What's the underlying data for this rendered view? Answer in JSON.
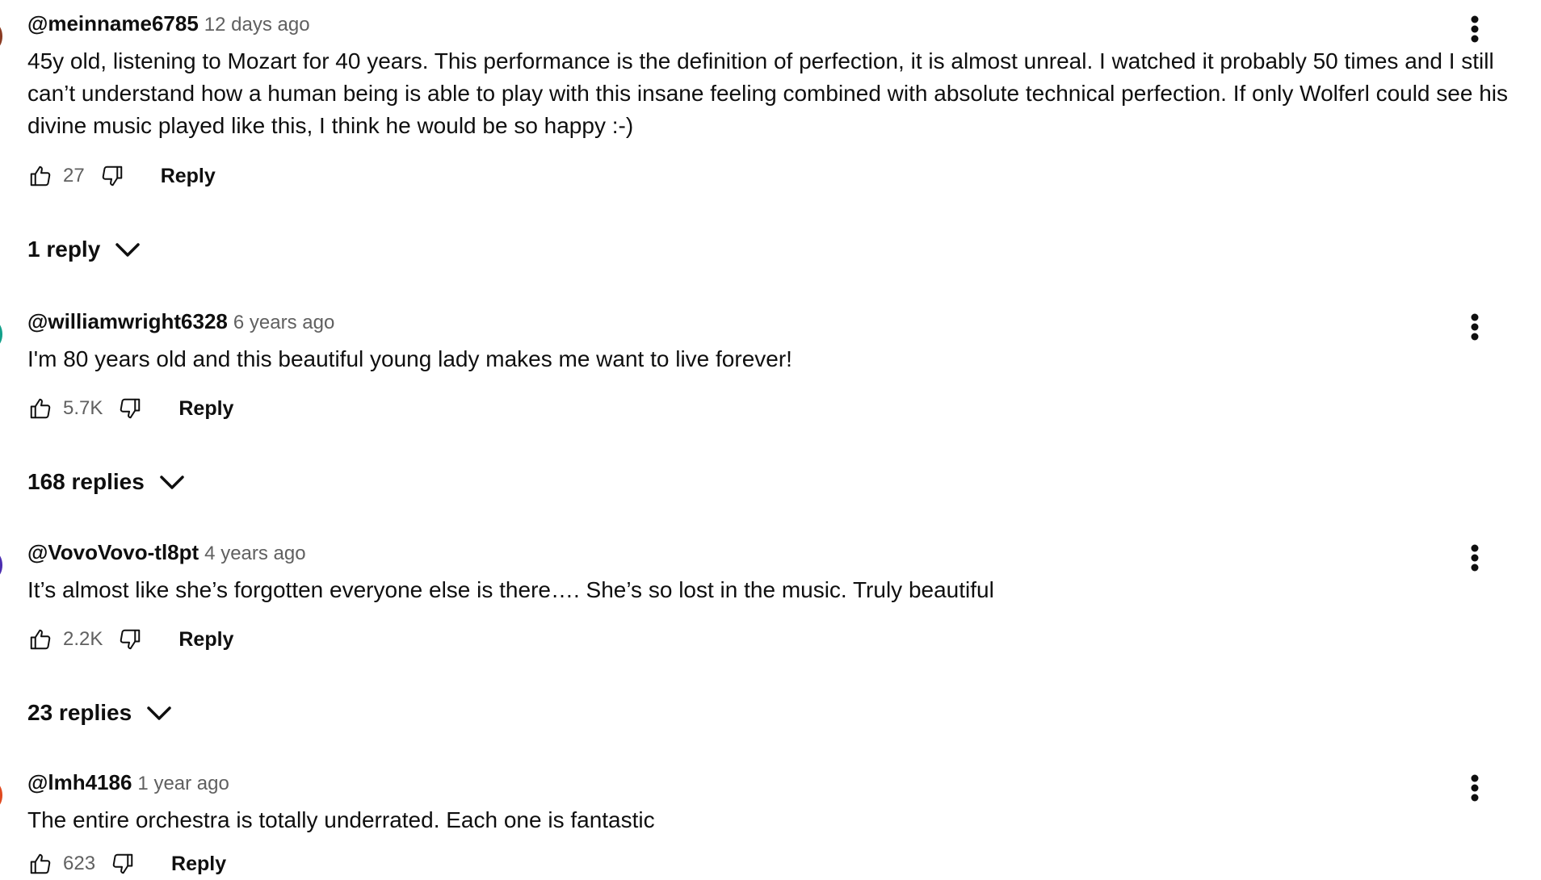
{
  "comments": [
    {
      "author": "@meinname6785",
      "time": "12 days ago",
      "text": "45y old, listening to Mozart for 40 years. This performance is the definition of perfection, it is almost unreal. I watched it probably 50 times and I still can’t understand how a human being is able to play with this insane feeling combined with absolute technical perfection. If only Wolferl could see his divine music played like this, I think he would be so happy :-)",
      "likes": "27",
      "reply_label": "Reply",
      "replies_label": "1 reply",
      "avatar_color": "#8a3b22"
    },
    {
      "author": "@williamwright6328",
      "time": "6 years ago",
      "text": "I'm 80 years old and this beautiful young lady makes me want to live forever!",
      "likes": "5.7K",
      "reply_label": "Reply",
      "replies_label": "168 replies",
      "avatar_color": "#12a08a"
    },
    {
      "author": "@VovoVovo-tl8pt",
      "time": "4 years ago",
      "text": "It’s almost like she’s forgotten everyone else is there…. She’s so lost in the music. Truly beautiful",
      "likes": "2.2K",
      "reply_label": "Reply",
      "replies_label": "23 replies",
      "avatar_color": "#4b2db0"
    },
    {
      "author": "@lmh4186",
      "time": "1 year ago",
      "text": "The entire orchestra is totally underrated. Each one is fantastic",
      "likes": "623",
      "reply_label": "Reply",
      "avatar_color": "#e0491f"
    }
  ],
  "icons": {
    "like": "thumbs-up-icon",
    "dislike": "thumbs-down-icon",
    "menu": "more-vert-icon",
    "expand": "chevron-down-icon"
  }
}
